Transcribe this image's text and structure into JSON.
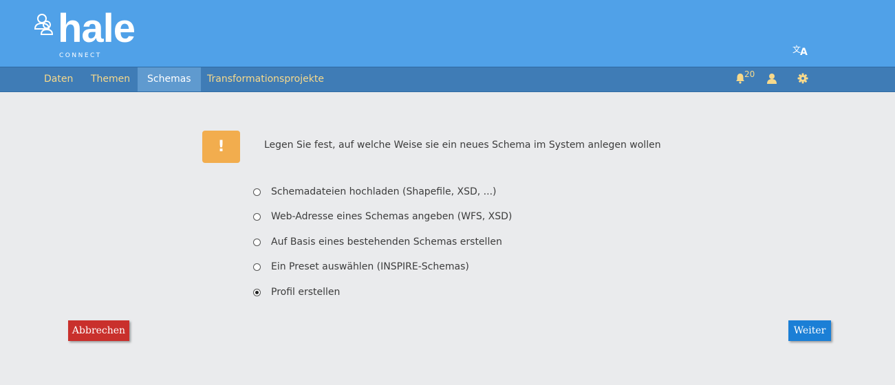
{
  "header": {
    "logo_text": "hale",
    "logo_subtext": "CONNECT",
    "language_icon": "translate-icon"
  },
  "nav": {
    "items": [
      {
        "label": "Daten",
        "active": false
      },
      {
        "label": "Themen",
        "active": false
      },
      {
        "label": "Schemas",
        "active": true
      },
      {
        "label": "Transformationsprojekte",
        "active": false
      }
    ],
    "notifications_icon": "bell-icon",
    "notifications_count": "20",
    "user_icon": "user-icon",
    "settings_icon": "gear-icon"
  },
  "main": {
    "warning_icon": "!",
    "prompt": "Legen Sie fest, auf welche Weise sie ein neues Schema im System anlegen wollen",
    "options": [
      {
        "label": "Schemadateien hochladen (Shapefile, XSD, ...)",
        "selected": false
      },
      {
        "label": "Web-Adresse eines Schemas angeben (WFS, XSD)",
        "selected": false
      },
      {
        "label": "Auf Basis eines bestehenden Schemas erstellen",
        "selected": false
      },
      {
        "label": "Ein Preset auswählen (INSPIRE-Schemas)",
        "selected": false
      },
      {
        "label": "Profil erstellen",
        "selected": true
      }
    ]
  },
  "buttons": {
    "cancel_label": "Abbrechen",
    "next_label": "Weiter"
  },
  "colors": {
    "header": "#50a1e8",
    "nav": "#3f7cb6",
    "nav_text": "#f7d98b",
    "warning": "#f2ad4e",
    "cancel": "#c9302c",
    "next": "#1b7fd6"
  }
}
